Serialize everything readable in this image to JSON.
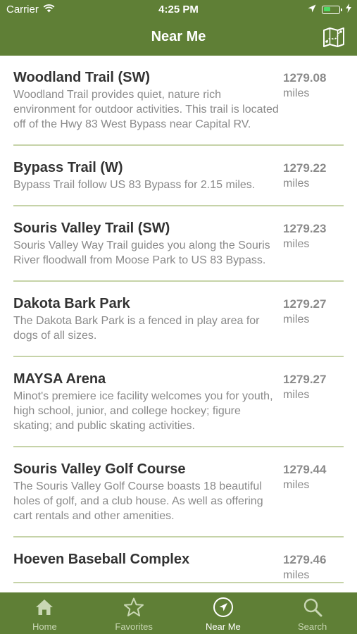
{
  "status_bar": {
    "carrier": "Carrier",
    "time": "4:25 PM"
  },
  "nav": {
    "title": "Near Me",
    "map_icon": "map-icon"
  },
  "colors": {
    "brand_green": "#5f7f36",
    "divider": "#c6d3a8",
    "title_text": "#333333",
    "secondary_text": "#8a8a8a",
    "battery_green": "#4cd964"
  },
  "places": [
    {
      "name": "Woodland Trail (SW)",
      "description": "Woodland Trail provides quiet, nature rich environment for outdoor activities. This trail is located off of the Hwy 83 West Bypass near Capital RV.",
      "distance": "1279.08",
      "unit": "miles"
    },
    {
      "name": "Bypass Trail (W)",
      "description": "Bypass Trail follow US 83 Bypass for 2.15 miles.",
      "distance": "1279.22",
      "unit": "miles"
    },
    {
      "name": "Souris Valley Trail (SW)",
      "description": "Souris Valley Way Trail guides you along the Souris River floodwall from Moose Park to US 83 Bypass.",
      "distance": "1279.23",
      "unit": "miles"
    },
    {
      "name": "Dakota Bark Park",
      "description": "The Dakota Bark Park is a fenced in play area for dogs of all sizes.",
      "distance": "1279.27",
      "unit": "miles"
    },
    {
      "name": "MAYSA Arena",
      "description": "Minot's premiere ice facility welcomes you for youth, high school, junior, and college hockey; figure skating; and public skating activities.",
      "distance": "1279.27",
      "unit": "miles"
    },
    {
      "name": "Souris Valley Golf Course",
      "description": "The Souris Valley Golf Course boasts 18 beautiful holes of golf, and a club house. As well as offering cart rentals and other amenities.",
      "distance": "1279.44",
      "unit": "miles"
    },
    {
      "name": "Hoeven Baseball Complex",
      "description": "",
      "distance": "1279.46",
      "unit": "miles"
    }
  ],
  "tabs": [
    {
      "label": "Home",
      "icon": "home-icon",
      "active": false
    },
    {
      "label": "Favorites",
      "icon": "star-icon",
      "active": false
    },
    {
      "label": "Near Me",
      "icon": "location-arrow-icon",
      "active": true
    },
    {
      "label": "Search",
      "icon": "search-icon",
      "active": false
    }
  ]
}
